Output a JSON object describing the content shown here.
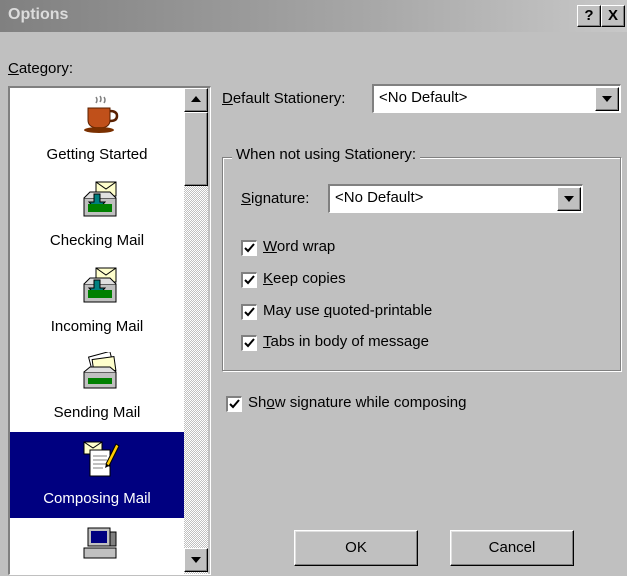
{
  "window": {
    "title": "Options",
    "help_label": "?",
    "close_label": "X"
  },
  "category": {
    "label": "Category:",
    "items": [
      {
        "label": "Getting Started",
        "icon": "coffee-cup-icon",
        "selected": false
      },
      {
        "label": "Checking Mail",
        "icon": "mail-inbox-icon",
        "selected": false
      },
      {
        "label": "Incoming Mail",
        "icon": "incoming-mail-icon",
        "selected": false
      },
      {
        "label": "Sending Mail",
        "icon": "sending-mail-icon",
        "selected": false
      },
      {
        "label": "Composing Mail",
        "icon": "compose-note-icon",
        "selected": true
      },
      {
        "label": "",
        "icon": "computer-icon",
        "selected": false
      }
    ]
  },
  "stationery": {
    "label": "Default Stationery:",
    "value": "<No Default>"
  },
  "group": {
    "title": "When not using Stationery:",
    "signature_label": "Signature:",
    "signature_value": "<No Default>",
    "options": [
      {
        "label": "Word wrap",
        "checked": true
      },
      {
        "label": "Keep copies",
        "checked": true
      },
      {
        "label": "May use quoted-printable",
        "checked": true
      },
      {
        "label": "Tabs in body of message",
        "checked": true
      }
    ]
  },
  "show_signature": {
    "label": "Show signature while composing",
    "checked": true
  },
  "buttons": {
    "ok": "OK",
    "cancel": "Cancel"
  },
  "colors": {
    "selection": "#000080",
    "face": "#c0c0c0"
  }
}
